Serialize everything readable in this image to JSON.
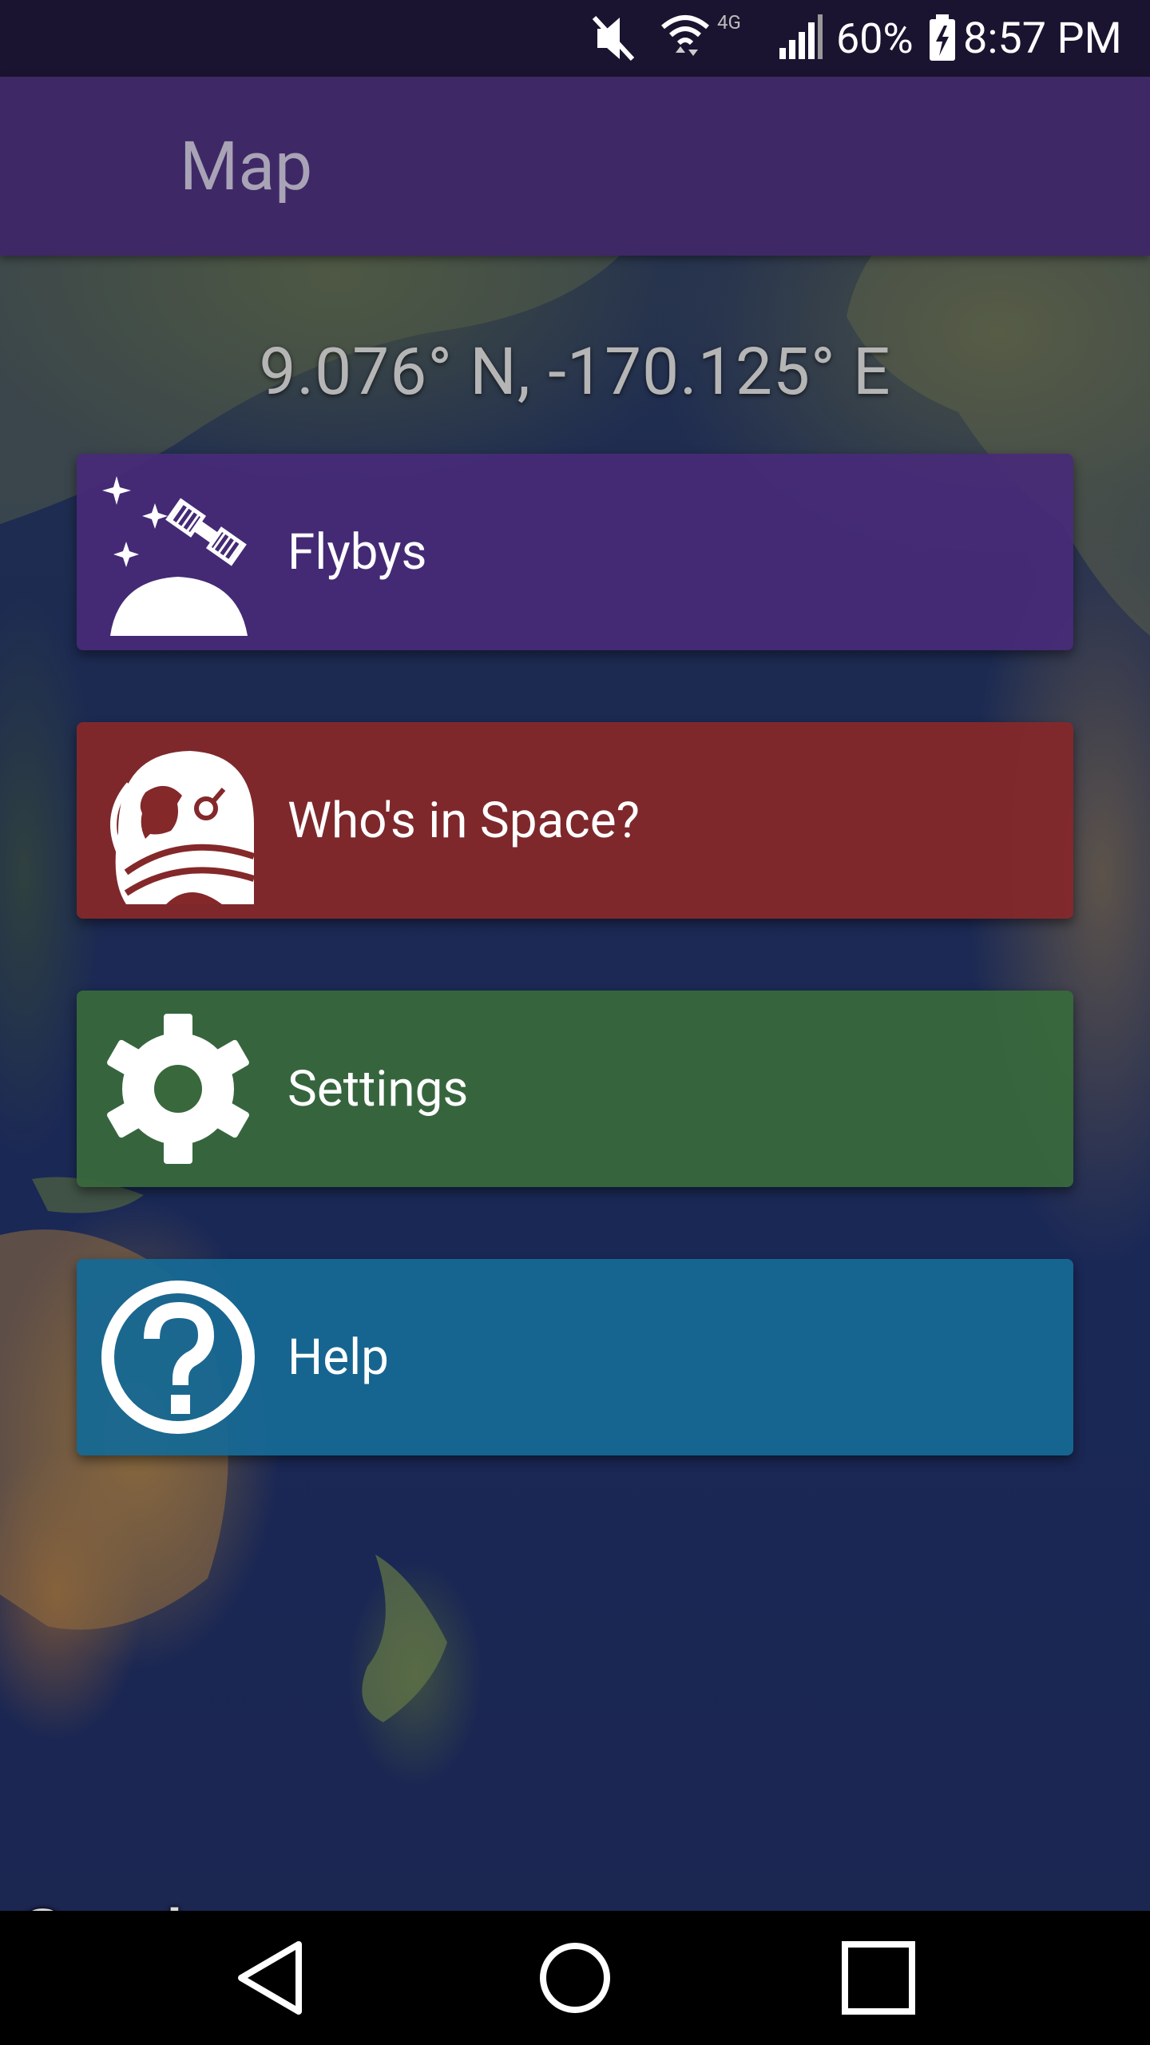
{
  "status_bar": {
    "battery_percent": "60%",
    "time": "8:57 PM",
    "network_label": "4G"
  },
  "app_bar": {
    "title": "Map"
  },
  "map": {
    "coordinates": "9.076° N, -170.125° E",
    "attribution": "Google"
  },
  "menu": [
    {
      "label": "Flybys",
      "icon": "satellite-icon",
      "color": "#482a78"
    },
    {
      "label": "Who's in Space?",
      "icon": "astronaut-icon",
      "color": "#84282a"
    },
    {
      "label": "Settings",
      "icon": "gear-icon",
      "color": "#38683c"
    },
    {
      "label": "Help",
      "icon": "question-icon",
      "color": "#166894"
    }
  ],
  "nav_bar": {
    "buttons": [
      "back-icon",
      "home-icon",
      "recents-icon"
    ]
  }
}
